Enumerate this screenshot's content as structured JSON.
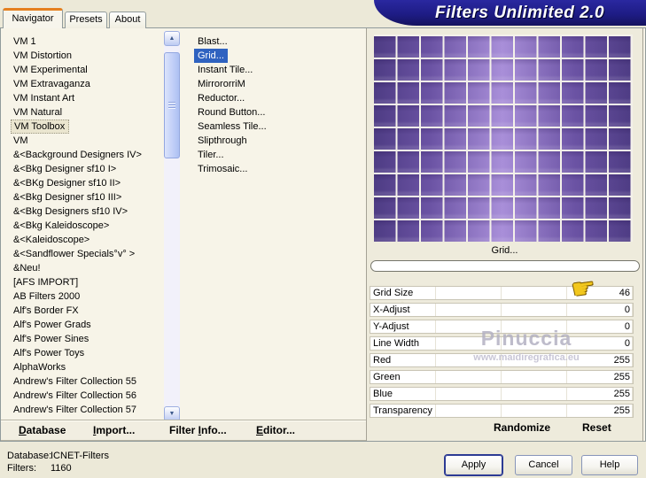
{
  "window": {
    "title": "Filters Unlimited 2.0"
  },
  "tabs": [
    {
      "label": "Navigator",
      "active": true
    },
    {
      "label": "Presets",
      "active": false
    },
    {
      "label": "About",
      "active": false
    }
  ],
  "navigator_list": {
    "selected_index": 6,
    "items": [
      "VM 1",
      "VM Distortion",
      "VM Experimental",
      "VM Extravaganza",
      "VM Instant Art",
      "VM Natural",
      "VM Toolbox",
      "VM",
      "&<Background Designers IV>",
      "&<Bkg Designer sf10 I>",
      "&<BKg Designer sf10 II>",
      "&<Bkg Designer sf10 III>",
      "&<Bkg Designers sf10 IV>",
      "&<Bkg Kaleidoscope>",
      "&<Kaleidoscope>",
      "&<Sandflower Specials°v° >",
      "&Neu!",
      "[AFS IMPORT]",
      "AB Filters 2000",
      "Alf's Border FX",
      "Alf's Power Grads",
      "Alf's Power Sines",
      "Alf's Power Toys",
      "AlphaWorks",
      "Andrew's Filter Collection 55",
      "Andrew's Filter Collection 56",
      "Andrew's Filter Collection 57"
    ]
  },
  "filter_list": {
    "selected_index": 1,
    "items": [
      "Blast...",
      "Grid...",
      "Instant Tile...",
      "MirrororriM",
      "Reductor...",
      "Round Button...",
      "Seamless Tile...",
      "Slipthrough",
      "Tiler...",
      "Trimosaic..."
    ]
  },
  "preview": {
    "caption": "Grid...",
    "gradient_dark": "#4e3c84",
    "gradient_light": "#a98fd9",
    "grid_line_color": "#f4f1ea",
    "progress_value": 0
  },
  "parameters": [
    {
      "label": "Grid Size",
      "value": "46"
    },
    {
      "label": "X-Adjust",
      "value": "0"
    },
    {
      "label": "Y-Adjust",
      "value": "0"
    },
    {
      "label": "Line Width",
      "value": "0"
    },
    {
      "label": "Red",
      "value": "255"
    },
    {
      "label": "Green",
      "value": "255"
    },
    {
      "label": "Blue",
      "value": "255"
    },
    {
      "label": "Transparency",
      "value": "255"
    }
  ],
  "watermark": {
    "name": "Pinuccia",
    "url": "www.maidiregrafica.eu"
  },
  "panel_actions": {
    "randomize": "Randomize",
    "reset": "Reset"
  },
  "menu_bar": [
    {
      "label": "Database",
      "pre": "",
      "mn": "D",
      "post": "atabase"
    },
    {
      "label": "Import...",
      "pre": "",
      "mn": "I",
      "post": "mport..."
    },
    {
      "label": "Filter Info...",
      "pre": "Filter ",
      "mn": "I",
      "post": "nfo..."
    },
    {
      "label": "Editor...",
      "pre": "",
      "mn": "E",
      "post": "ditor..."
    }
  ],
  "status": {
    "database_label": "Database:",
    "database_value": "ICNET-Filters",
    "filters_label": "Filters:",
    "filters_value": "1160"
  },
  "dialog_buttons": [
    {
      "label": "Apply",
      "default": true
    },
    {
      "label": "Cancel",
      "default": false
    },
    {
      "label": "Help",
      "default": false
    }
  ],
  "icons": {
    "hand_pointer": "☛",
    "scroll_up": "▲",
    "scroll_down": "▼"
  },
  "colors": {
    "selection_blue": "#2f62c0",
    "banner_navy": "#1e1c85",
    "tab_accent_orange": "#e5801f",
    "dialog_bg": "#ece9d8",
    "hand_yellow": "#f2c71d"
  }
}
